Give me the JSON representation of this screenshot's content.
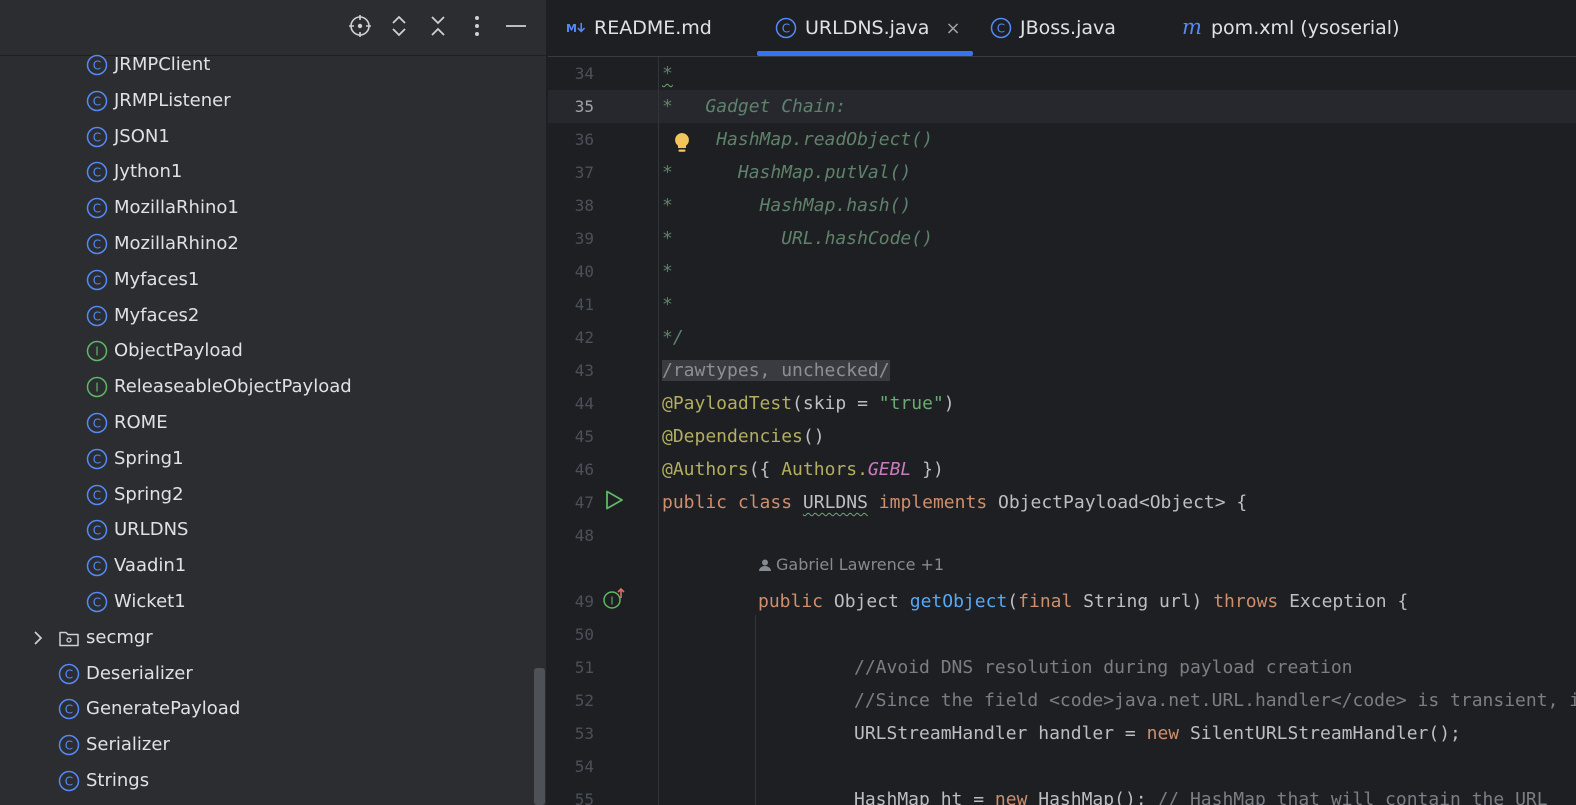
{
  "tree": {
    "payload_items": [
      {
        "label": "JRMPClient",
        "kind": "class"
      },
      {
        "label": "JRMPListener",
        "kind": "class"
      },
      {
        "label": "JSON1",
        "kind": "class"
      },
      {
        "label": "Jython1",
        "kind": "class"
      },
      {
        "label": "MozillaRhino1",
        "kind": "class"
      },
      {
        "label": "MozillaRhino2",
        "kind": "class"
      },
      {
        "label": "Myfaces1",
        "kind": "class"
      },
      {
        "label": "Myfaces2",
        "kind": "class"
      },
      {
        "label": "ObjectPayload",
        "kind": "interface"
      },
      {
        "label": "ReleaseableObjectPayload",
        "kind": "interface"
      },
      {
        "label": "ROME",
        "kind": "class"
      },
      {
        "label": "Spring1",
        "kind": "class"
      },
      {
        "label": "Spring2",
        "kind": "class"
      },
      {
        "label": "URLDNS",
        "kind": "class"
      },
      {
        "label": "Vaadin1",
        "kind": "class"
      },
      {
        "label": "Wicket1",
        "kind": "class"
      }
    ],
    "package": {
      "label": "secmgr",
      "icon": "package-folder-icon"
    },
    "root_items": [
      {
        "label": "Deserializer",
        "kind": "class"
      },
      {
        "label": "GeneratePayload",
        "kind": "class"
      },
      {
        "label": "Serializer",
        "kind": "class"
      },
      {
        "label": "Strings",
        "kind": "class"
      }
    ]
  },
  "toolbar": {
    "icons": [
      "locate-icon",
      "expand-all-icon",
      "collapse-all-icon",
      "more-options-icon",
      "hide-panel-icon"
    ]
  },
  "tabs": [
    {
      "label": "README.md",
      "icon": "markdown-icon",
      "active": false
    },
    {
      "label": "URLDNS.java",
      "icon": "class-icon",
      "active": true,
      "close": "×"
    },
    {
      "label": "JBoss.java",
      "icon": "class-icon",
      "active": false
    },
    {
      "label": "pom.xml (ysoserial)",
      "icon": "maven-icon",
      "active": false
    }
  ],
  "editor": {
    "current_line": "35",
    "line_numbers": [
      "34",
      "35",
      "36",
      "37",
      "38",
      "39",
      "40",
      "41",
      "42",
      "43",
      "44",
      "45",
      "46",
      "47",
      "48",
      "49",
      "50",
      "51",
      "52",
      "53",
      "54",
      "55"
    ],
    "code": {
      "l34": "*",
      "l35_star": "*",
      "l35": "Gadget Chain:",
      "l36": "HashMap.readObject()",
      "l37_star": "*",
      "l37": "HashMap.putVal()",
      "l38_star": "*",
      "l38": "HashMap.hash()",
      "l39_star": "*",
      "l39": "URL.hashCode()",
      "l40": "*",
      "l41": "*",
      "l42": "*/",
      "l43": "/rawtypes, unchecked/",
      "l44_ann": "@PayloadTest",
      "l44_open": "(skip = ",
      "l44_str": "\"true\"",
      "l44_close": ")",
      "l45_ann": "@Dependencies",
      "l45_rest": "()",
      "l46_ann": "@Authors",
      "l46_open": "({ ",
      "l46_cls": "Authors.",
      "l46_const": "GEBL",
      "l46_close": " })",
      "l47_kw1": "public",
      "l47_kw2": "class",
      "l47_name": "URLDNS",
      "l47_kw3": "implements",
      "l47_rest": "ObjectPayload<Object> {",
      "author_hint": "Gabriel Lawrence +1",
      "l49_kw1": "public",
      "l49_type": "Object",
      "l49_fn": "getObject",
      "l49_open": "(",
      "l49_kw2": "final",
      "l49_params": "String url) ",
      "l49_kw3": "throws",
      "l49_rest": " Exception {",
      "l51": "//Avoid DNS resolution during payload creation",
      "l52": "//Since the field <code>java.net.URL.handler</code> is transient, it will not be part of the serialized payload.",
      "l53_a": "URLStreamHandler handler = ",
      "l53_kw": "new",
      "l53_b": " SilentURLStreamHandler();",
      "l55_a": "HashMap ht = ",
      "l55_kw": "new",
      "l55_b": " HashMap(); ",
      "l55_cm": "// HashMap that will contain the URL"
    }
  },
  "colors": {
    "accent": "#3574f0",
    "class_icon": "#548af7",
    "interface_icon": "#5fb865",
    "comment": "#5f826b",
    "keyword": "#cf8e6d",
    "string": "#6aab73",
    "annotation": "#b3ae60",
    "function": "#56a8f5"
  }
}
